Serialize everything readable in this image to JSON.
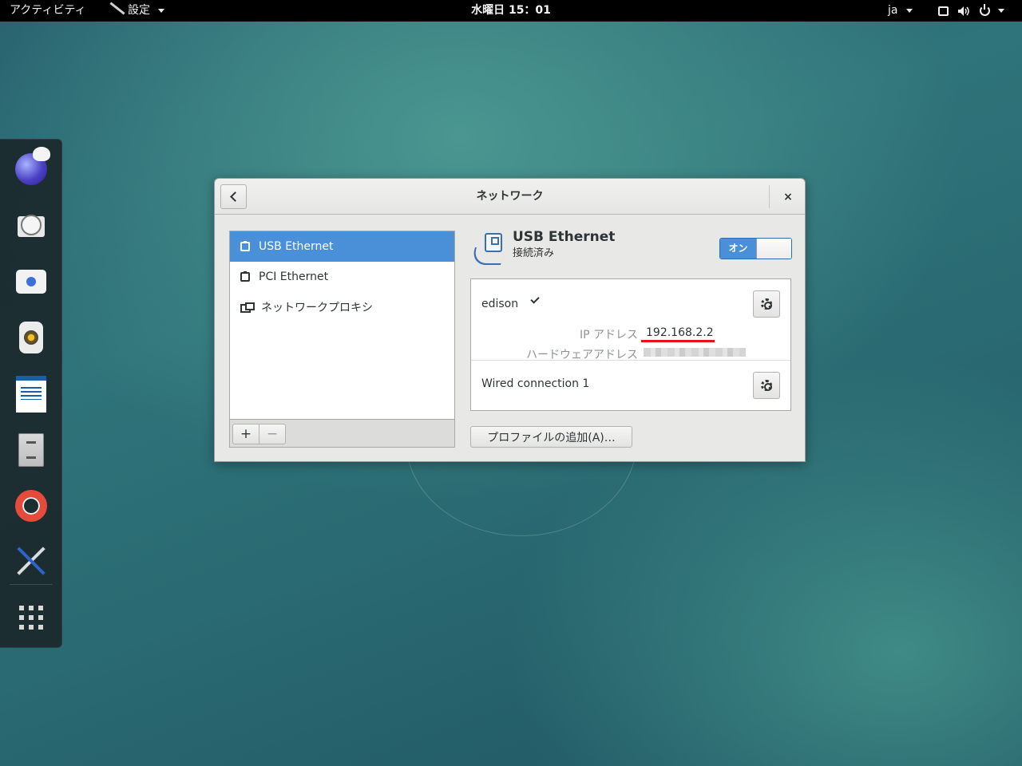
{
  "topbar": {
    "activities": "アクティビティ",
    "app_menu": "設定",
    "clock": "水曜日 15：01",
    "lang": "ja",
    "icons": [
      "screen-icon",
      "volume-icon",
      "power-icon"
    ]
  },
  "dash": {
    "apps": [
      "web-browser",
      "mail-clock",
      "chat",
      "rhythmbox",
      "libreoffice-writer",
      "file-cabinet",
      "help",
      "settings-tools",
      "show-applications"
    ]
  },
  "window": {
    "title": "ネットワーク",
    "close_label": "×",
    "devices": [
      {
        "label": "USB Ethernet",
        "icon": "ethernet-icon",
        "selected": true
      },
      {
        "label": "PCI Ethernet",
        "icon": "ethernet-icon",
        "selected": false
      },
      {
        "label": "ネットワークプロキシ",
        "icon": "proxy-icon",
        "selected": false
      }
    ],
    "toolbar": {
      "add_label": "+",
      "remove_label": "−"
    },
    "details": {
      "device_name": "USB Ethernet",
      "status": "接続済み",
      "switch_label": "オン",
      "switch_on": true,
      "connections": [
        {
          "name": "edison",
          "active": true
        },
        {
          "name": "Wired connection 1",
          "active": false
        }
      ],
      "ip_label": "IP アドレス",
      "ip_value": "192.168.2.2",
      "hw_label": "ハードウェアアドレス",
      "add_profile_label": "プロファイルの追加(A)…"
    }
  },
  "colors": {
    "accent": "#4a90d9",
    "topbar_bg": "#000000",
    "annotation_underline": "#e8121a"
  }
}
